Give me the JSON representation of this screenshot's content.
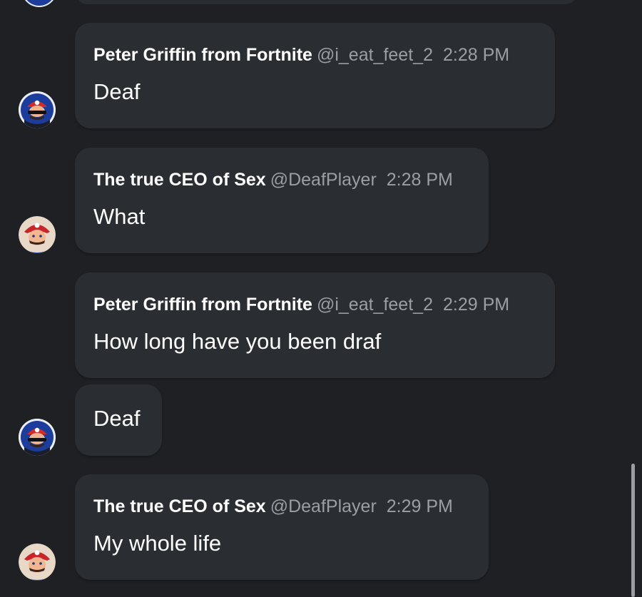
{
  "messages": [
    {
      "author": "Peter Griffin from Fortnite",
      "handle": "@i_eat_feet_2",
      "time": "2:28 PM",
      "text": "Deaf",
      "avatar": "mario-glasses-avatar-icon"
    },
    {
      "author": "The true CEO of Sex",
      "handle": "@DeafPlayer",
      "time": "2:28 PM",
      "text": "What",
      "avatar": "mario-avatar-icon"
    },
    {
      "author": "Peter Griffin from Fortnite",
      "handle": "@i_eat_feet_2",
      "time": "2:29 PM",
      "text": "How long have you been draf",
      "avatar": "mario-glasses-avatar-icon"
    },
    {
      "text": "Deaf",
      "avatar": "mario-glasses-avatar-icon"
    },
    {
      "author": "The true CEO of Sex",
      "handle": "@DeafPlayer",
      "time": "2:29 PM",
      "text": "My whole life",
      "avatar": "mario-avatar-icon"
    }
  ],
  "colors": {
    "background": "#1f2023",
    "bubble": "#2a2d31",
    "name": "#ffffff",
    "meta": "#9b9ea3",
    "avatar_blue": "#1d3d9c"
  }
}
